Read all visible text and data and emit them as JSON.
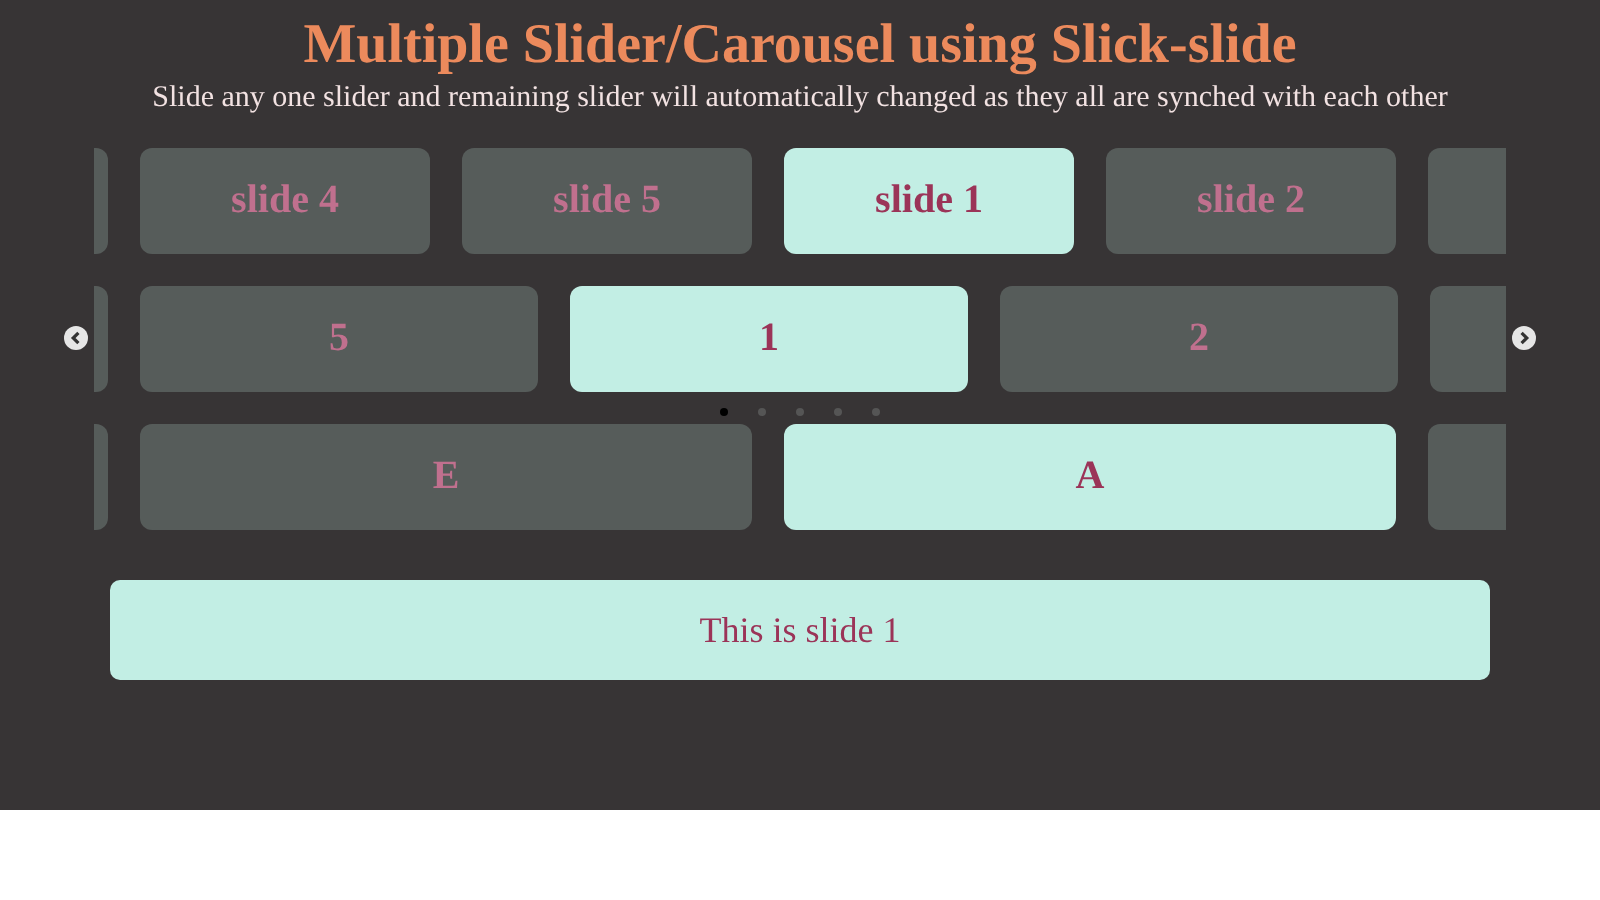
{
  "title": "Multiple Slider/Carousel using Slick-slide",
  "subtitle": "Slide any one slider and remaining slider will automatically changed as they all are synched with each other",
  "carousels": [
    {
      "kind": "small",
      "slides": [
        {
          "label": "slide 4",
          "selected": false
        },
        {
          "label": "slide 5",
          "selected": false
        },
        {
          "label": "slide 1",
          "selected": true
        },
        {
          "label": "slide 2",
          "selected": false
        }
      ]
    },
    {
      "kind": "medium",
      "slides": [
        {
          "label": "5",
          "selected": false
        },
        {
          "label": "1",
          "selected": true
        },
        {
          "label": "2",
          "selected": false
        }
      ],
      "dots": [
        {
          "selected": true
        },
        {
          "selected": false
        },
        {
          "selected": false
        },
        {
          "selected": false
        },
        {
          "selected": false
        }
      ]
    },
    {
      "kind": "large",
      "slides": [
        {
          "label": "E",
          "selected": false
        },
        {
          "label": "A",
          "selected": true
        }
      ]
    }
  ],
  "content": "This is slide 1"
}
